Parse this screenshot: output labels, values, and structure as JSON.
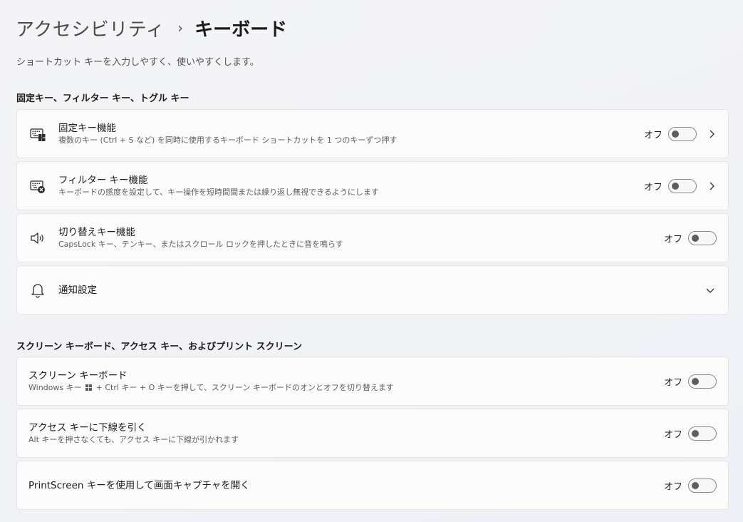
{
  "breadcrumb": {
    "parent": "アクセシビリティ",
    "separator": "›",
    "current": "キーボード"
  },
  "subtitle": "ショートカット キーを入力しやすく、使いやすくします。",
  "section1": {
    "title": "固定キー、フィルター キー、トグル キー",
    "items": [
      {
        "title": "固定キー機能",
        "desc": "複数のキー (Ctrl + S など) を同時に使用するキーボード ショートカットを 1 つのキーずつ押す",
        "state": "オフ",
        "icon": "sticky-keys-icon"
      },
      {
        "title": "フィルター キー機能",
        "desc": "キーボードの感度を設定して、キー操作を短時間間または繰り返し無視できるようにします",
        "state": "オフ",
        "icon": "filter-keys-icon"
      },
      {
        "title": "切り替えキー機能",
        "desc": "CapsLock キー、テンキー、またはスクロール ロックを押したときに音を鳴らす",
        "state": "オフ",
        "icon": "speaker-icon"
      },
      {
        "title": "通知設定",
        "icon": "bell-icon"
      }
    ]
  },
  "section2": {
    "title": "スクリーン キーボード、アクセス キー、およびプリント スクリーン",
    "items": [
      {
        "title": "スクリーン キーボード",
        "desc_pre": "Windows キー ",
        "desc_post": " + Ctrl キー + O キーを押して、スクリーン キーボードのオンとオフを切り替えます",
        "state": "オフ"
      },
      {
        "title": "アクセス キーに下線を引く",
        "desc": "Alt キーを押さなくても、アクセス キーに下線が引かれます",
        "state": "オフ"
      },
      {
        "title": "PrintScreen キーを使用して画面キャプチャを開く",
        "state": "オフ"
      }
    ]
  }
}
